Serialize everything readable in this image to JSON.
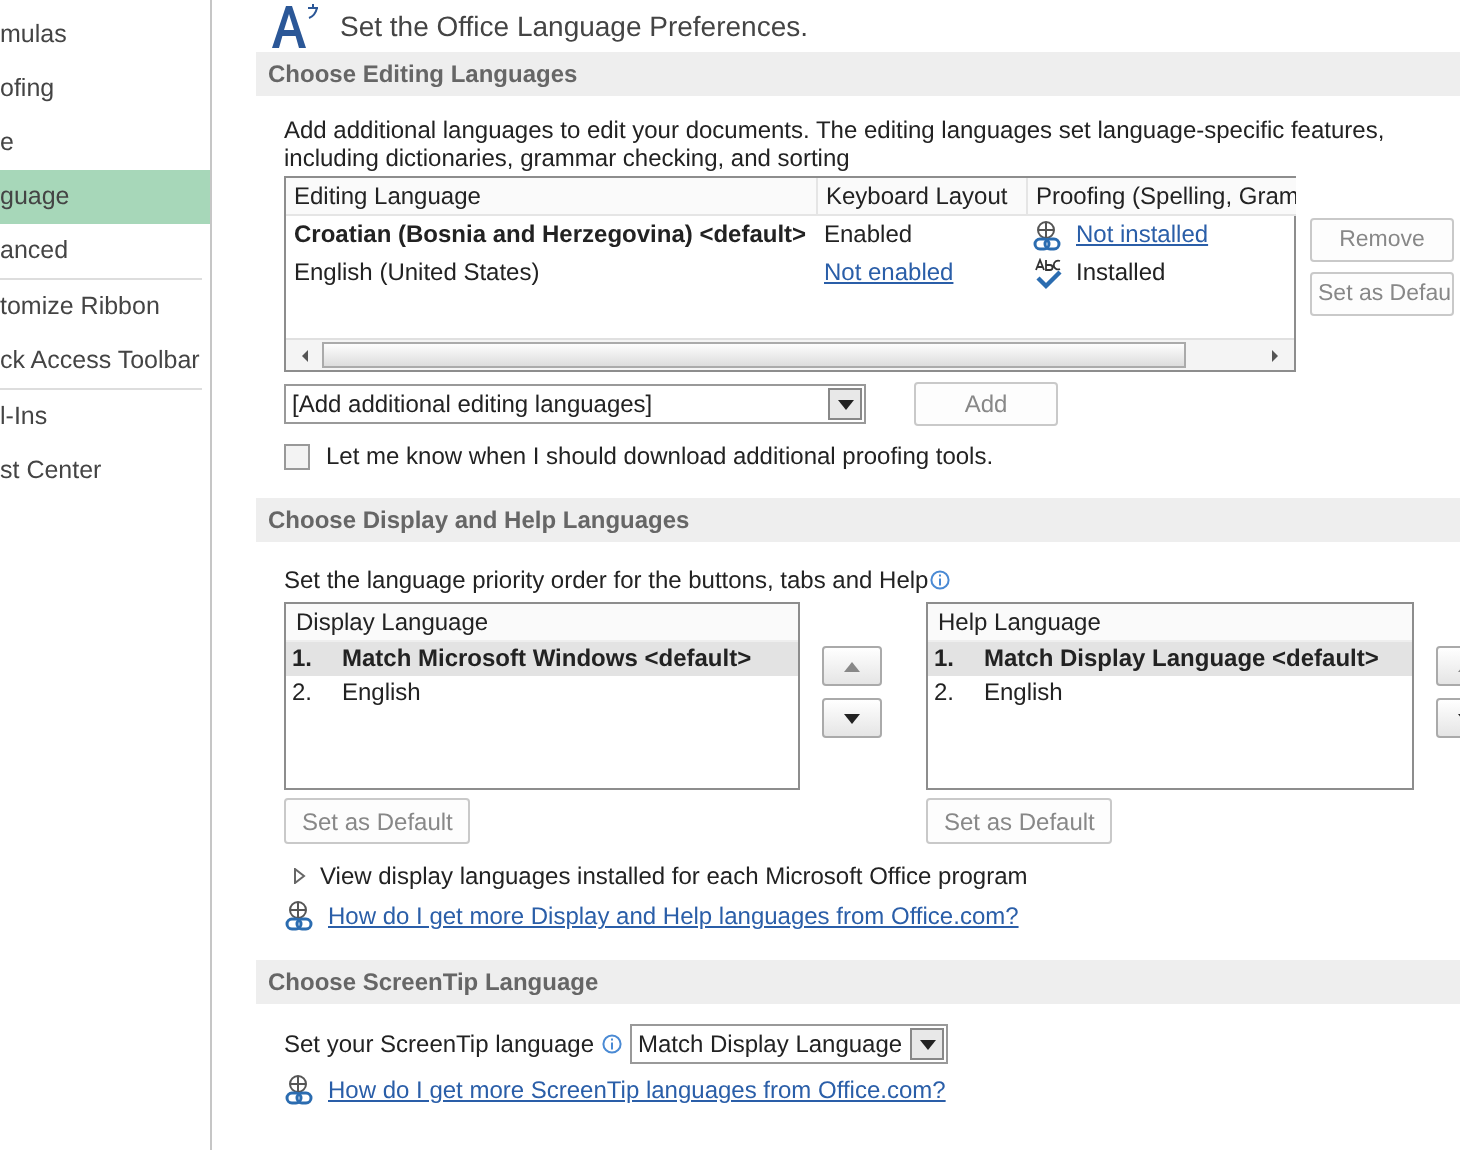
{
  "sidebar": {
    "items": [
      {
        "label": "mulas",
        "selected": false,
        "separator_after": false
      },
      {
        "label": "ofing",
        "selected": false,
        "separator_after": false
      },
      {
        "label": "e",
        "selected": false,
        "separator_after": false
      },
      {
        "label": "guage",
        "selected": true,
        "separator_after": false
      },
      {
        "label": "anced",
        "selected": false,
        "separator_after": true
      },
      {
        "label": "tomize Ribbon",
        "selected": false,
        "separator_after": false
      },
      {
        "label": "ck Access Toolbar",
        "selected": false,
        "separator_after": true
      },
      {
        "label": "l-Ins",
        "selected": false,
        "separator_after": false
      },
      {
        "label": "st Center",
        "selected": false,
        "separator_after": false
      }
    ]
  },
  "heading": "Set the Office Language Preferences.",
  "editing": {
    "title": "Choose Editing Languages",
    "description": "Add additional languages to edit your documents. The editing languages set language-specific features, including dictionaries, grammar checking, and sorting",
    "columns": [
      "Editing Language",
      "Keyboard Layout",
      "Proofing (Spelling, Gram"
    ],
    "rows": [
      {
        "language": "Croatian (Bosnia and Herzegovina) <default>",
        "default": true,
        "keyboard": {
          "text": "Enabled",
          "kind": "text"
        },
        "proofing": {
          "text": "Not installed",
          "kind": "link"
        }
      },
      {
        "language": "English (United States)",
        "default": false,
        "keyboard": {
          "text": "Not enabled",
          "kind": "link"
        },
        "proofing": {
          "text": "Installed",
          "kind": "text"
        }
      }
    ],
    "side_buttons": [
      "Remove",
      "Set as Defau"
    ],
    "add_combo": {
      "value": "[Add additional editing languages]"
    },
    "add_button": "Add",
    "checkbox": {
      "label": "Let me know when I should download additional proofing tools.",
      "checked": false
    }
  },
  "display": {
    "title": "Choose Display and Help Languages",
    "description": "Set the language priority order for the buttons, tabs and Help",
    "lists": [
      {
        "header": "Display Language",
        "items": [
          {
            "number": "1.",
            "label": "Match Microsoft Windows <default>",
            "default": true,
            "selected": true
          },
          {
            "number": "2.",
            "label": "English",
            "default": false,
            "selected": false
          }
        ],
        "button": "Set as Default"
      },
      {
        "header": "Help Language",
        "items": [
          {
            "number": "1.",
            "label": "Match Display Language <default>",
            "default": true,
            "selected": true
          },
          {
            "number": "2.",
            "label": "English",
            "default": false,
            "selected": false
          }
        ],
        "button": "Set as Default"
      }
    ],
    "expander": "View display languages installed for each Microsoft Office program",
    "link": "How do I get more Display and Help languages from Office.com?"
  },
  "screentip": {
    "title": "Choose ScreenTip Language",
    "label": "Set your ScreenTip language",
    "combo": {
      "value": "Match Display Language"
    },
    "link": "How do I get more ScreenTip languages from Office.com?"
  }
}
